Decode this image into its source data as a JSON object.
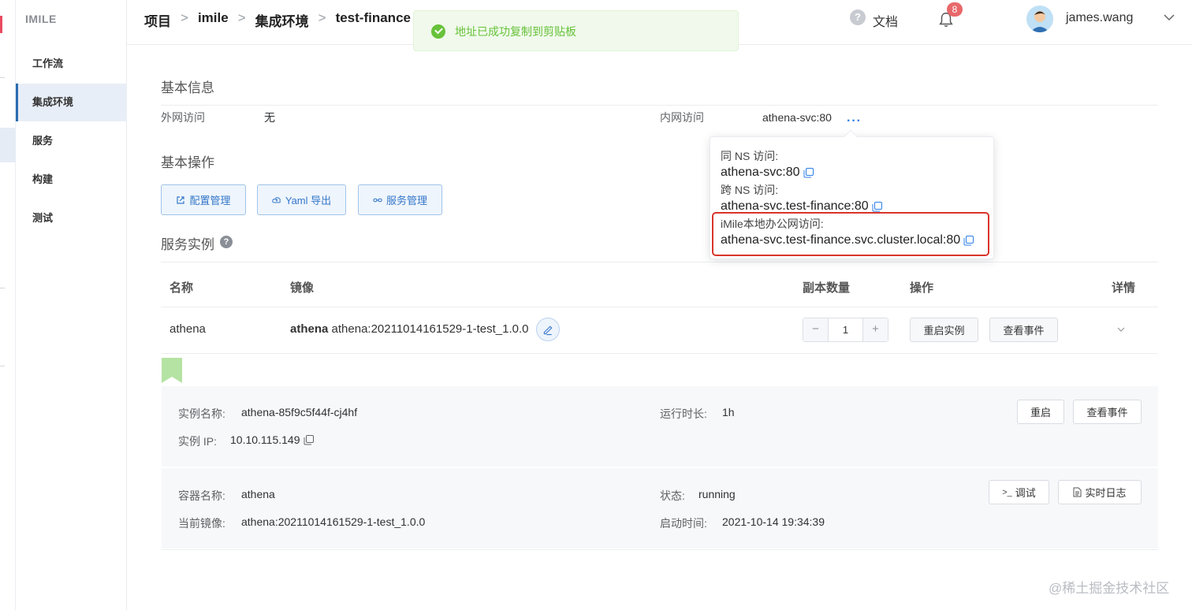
{
  "sidebar": {
    "brand": "IMILE",
    "items": [
      {
        "label": "工作流"
      },
      {
        "label": "集成环境",
        "active": true
      },
      {
        "label": "服务"
      },
      {
        "label": "构建"
      },
      {
        "label": "测试"
      }
    ]
  },
  "header": {
    "breadcrumb": [
      "项目",
      "imile",
      "集成环境",
      "test-finance"
    ],
    "breadcrumb_sep": ">",
    "docs_label": "文档",
    "notification_count": "8",
    "username": "james.wang",
    "icons": [
      "help-icon",
      "bell-icon",
      "chevron-down-icon"
    ]
  },
  "toast": {
    "message": "地址已成功复制到剪贴板",
    "type": "success",
    "color": "#67c23a"
  },
  "basic_info": {
    "title": "基本信息",
    "external_label": "外网访问",
    "external_value": "无",
    "internal_label": "内网访问",
    "internal_value": "athena-svc:80",
    "more": "···"
  },
  "popover": {
    "same_ns_label": "同 NS 访问:",
    "same_ns_addr": "athena-svc:80",
    "cross_ns_label": "跨 NS 访问:",
    "cross_ns_addr": "athena-svc.test-finance:80",
    "office_label": "iMile本地办公网访问:",
    "office_addr": "athena-svc.test-finance.svc.cluster.local:80"
  },
  "basic_ops": {
    "title": "基本操作",
    "buttons": [
      "配置管理",
      "Yaml 导出",
      "服务管理"
    ]
  },
  "instances": {
    "title": "服务实例",
    "columns": [
      "名称",
      "镜像",
      "副本数量",
      "操作",
      "详情"
    ],
    "rows": [
      {
        "name": "athena",
        "image_name": "athena",
        "image_tag": "athena:20211014161529-1-test_1.0.0",
        "replicas": "1",
        "actions": [
          "重启实例",
          "查看事件"
        ]
      }
    ]
  },
  "detail": {
    "instance_name_label": "实例名称:",
    "instance_name": "athena-85f9c5f44f-cj4hf",
    "uptime_label": "运行时长:",
    "uptime": "1h",
    "instance_ip_label": "实例 IP:",
    "instance_ip": "10.10.115.149",
    "restart_btn": "重启",
    "events_btn": "查看事件",
    "container_label": "容器名称:",
    "container": "athena",
    "status_label": "状态:",
    "status": "running",
    "image_label": "当前镜像:",
    "image": "athena:20211014161529-1-test_1.0.0",
    "start_label": "启动时间:",
    "start_time": "2021-10-14 19:34:39",
    "debug_btn": "调试",
    "log_btn": "实时日志"
  },
  "watermark": "@稀土掘金技术社区",
  "colors": {
    "accent": "#2b6cb0",
    "highlight_box": "#d9352a",
    "button_blue": "#3577c9"
  }
}
